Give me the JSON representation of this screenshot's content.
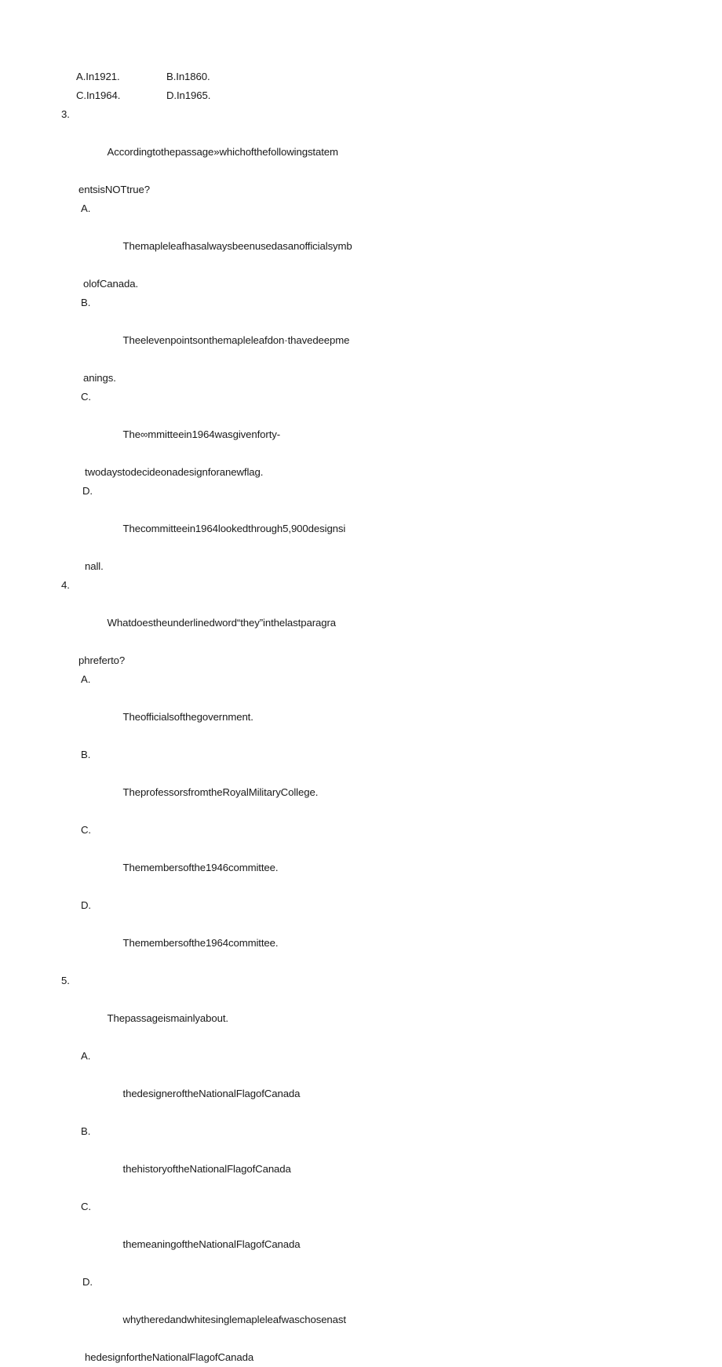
{
  "document": {
    "page_background": "#ffffff",
    "text_color": "#1a1a1a"
  },
  "answers_row_1": {
    "option_a": "A.In1921.",
    "option_b": "B.In1860."
  },
  "answers_row_2": {
    "option_c": "C.In1964.",
    "option_d": "D.In1965."
  },
  "questions": [
    {
      "number": "3.",
      "stem_line_1": "Accordingtothepassage»whichofthefollowingstatem",
      "stem_line_2": "entsisNOTtrue?",
      "options": [
        {
          "letter": "A.",
          "line_1": "Themapleleafhasalwaysbeenusedasanofficialsymb",
          "line_2": "olofCanada."
        },
        {
          "letter": "B.",
          "line_1": "Theelevenpointsonthemapleleafdon·thavedeepme",
          "line_2": "anings."
        },
        {
          "letter": "C.",
          "line_1": "The∞mmitteein1964wasgivenforty-",
          "line_2": "twodaystodecideonadesignforanewflag."
        },
        {
          "letter": "D.",
          "line_1": "Thecommitteein1964lookedthrough5,900designsi",
          "line_2": "nall."
        }
      ]
    },
    {
      "number": "4.",
      "stem_line_1": "Whatdoestheunderlinedword“they”inthelastparagra",
      "stem_line_2": "phreferto?",
      "options": [
        {
          "letter": "A.",
          "line_1": "Theofficialsofthegovernment.",
          "line_2": ""
        },
        {
          "letter": "B.",
          "line_1": "TheprofessorsfromtheRoyalMilitaryCollege.",
          "line_2": ""
        },
        {
          "letter": "C.",
          "line_1": "Themembersofthe1946committee.",
          "line_2": ""
        },
        {
          "letter": "D.",
          "line_1": "Themembersofthe1964committee.",
          "line_2": ""
        }
      ]
    },
    {
      "number": "5.",
      "stem_line_1": "Thepassageismainlyabout.",
      "stem_line_2": "",
      "options": [
        {
          "letter": "A.",
          "line_1": "thedesigneroftheNationalFlagofCanada",
          "line_2": ""
        },
        {
          "letter": "B.",
          "line_1": "thehistoryoftheNationalFlagofCanada",
          "line_2": ""
        },
        {
          "letter": "C.",
          "line_1": "themeaningoftheNationalFlagofCanada",
          "line_2": ""
        },
        {
          "letter": "D.",
          "line_1": "whytheredandwhitesinglemapleleafwaschosenast",
          "line_2": "hedesignfortheNationalFlagofCanada"
        }
      ]
    }
  ]
}
